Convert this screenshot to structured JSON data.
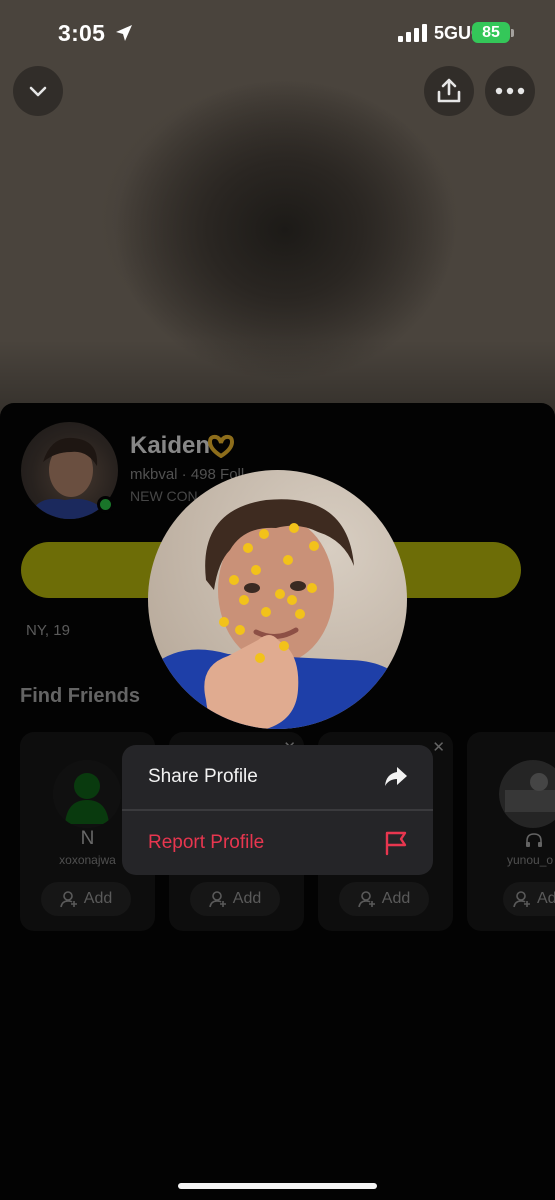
{
  "status_bar": {
    "time": "3:05",
    "network": "5GUC",
    "battery": "85"
  },
  "profile": {
    "name": "Kaiden",
    "meta": "mkbval · 498 Foll",
    "meta2": "NEW CON",
    "location_age": "NY, 19"
  },
  "find_friends": {
    "title": "Find Friends",
    "add_label": "Add",
    "cards": [
      {
        "initial": "N",
        "username": "xoxonajwa"
      },
      {
        "initial": "",
        "username": ""
      },
      {
        "initial": "",
        "username": ""
      },
      {
        "initial": "",
        "username": "yunou_o"
      }
    ]
  },
  "context_menu": {
    "share_label": "Share Profile",
    "report_label": "Report Profile"
  },
  "colors": {
    "accent_yellow": "#a8a80c",
    "report_red": "#e8364f",
    "online_green": "#27b43f",
    "battery_green": "#34c759"
  },
  "icons": {
    "collapse": "chevron-down-icon",
    "share": "share-upload-icon",
    "more": "more-dots-icon",
    "share_menu": "share-arrow-icon",
    "report_menu": "flag-icon",
    "add_friend": "add-user-icon"
  }
}
